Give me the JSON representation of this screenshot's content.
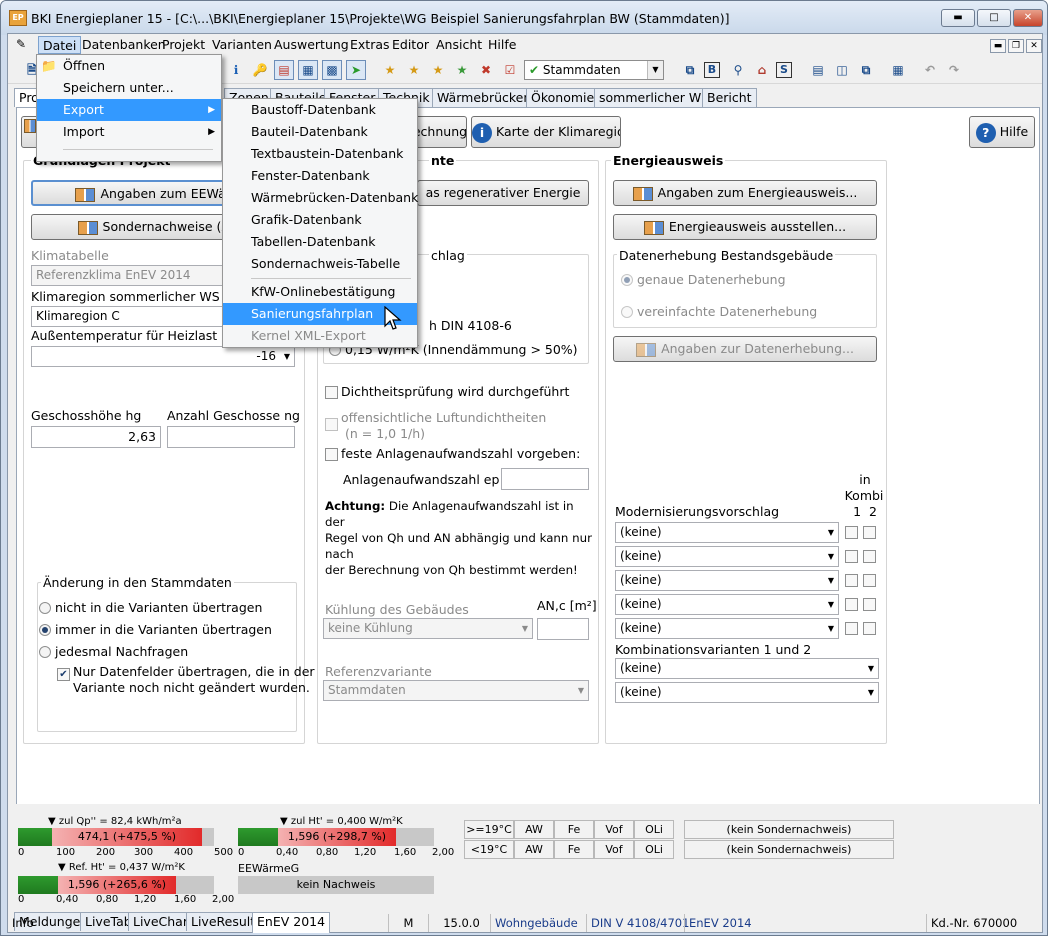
{
  "window": {
    "title": "BKI Energieplaner 15 - [C:\\...\\BKI\\Energieplaner 15\\Projekte\\WG Beispiel Sanierungsfahrplan BW (Stammdaten)]"
  },
  "menubar": [
    "Datei",
    "Datenbanken",
    "Projekt",
    "Varianten",
    "Auswertung",
    "Extras",
    "Editor",
    "Ansicht",
    "Hilfe"
  ],
  "toolbar": {
    "variant_selected": "Stammdaten",
    "text_icons": [
      "B",
      "S"
    ]
  },
  "tabs": [
    "Pro",
    "Zonen",
    "Bauteile",
    "Fenster",
    "Technik",
    "Wärmebrücken",
    "Ökonomie",
    "sommerlicher WS",
    "Bericht"
  ],
  "datei_menu": {
    "items": [
      "Öffnen",
      "Speichern unter...",
      "Export",
      "Import"
    ]
  },
  "export_menu": {
    "items": [
      "Baustoff-Datenbank",
      "Bauteil-Datenbank",
      "Textbaustein-Datenbank",
      "Fenster-Datenbank",
      "Wärmebrücken-Datenbank",
      "Grafik-Datenbank",
      "Tabellen-Datenbank",
      "Sondernachweis-Tabelle",
      "KfW-Onlinebestätigung",
      "Sanierungsfahrplan",
      "Kernel XML-Export"
    ],
    "highlighted": "Sanierungsfahrplan",
    "disabled": "Kernel XML-Export"
  },
  "topbuttons": {
    "berechnung": "rechnung",
    "klimaregionen": "Karte der Klimaregionen",
    "hilfe": "Hilfe"
  },
  "left": {
    "title": "Grundlagen Projekt",
    "btn_eew": "Angaben zum EEWärme",
    "btn_sonder": "Sondernachweise (z. B.",
    "klimatabelle_label": "Klimatabelle",
    "klimatabelle_value": "Referenzklima EnEV 2014",
    "klimaregion_label": "Klimaregion sommerlicher WS",
    "klimaregion_value": "Klimaregion C",
    "aussentemp_label": "Außentemperatur für Heizlast DIN E",
    "aussentemp_value": "-16",
    "geschoss_label": "Geschosshöhe hg",
    "geschoss_value": "2,63",
    "anzahl_label": "Anzahl Geschosse ng",
    "anzahl_value": "",
    "aenderung_title": "Änderung in den Stammdaten",
    "radio1": "nicht in die Varianten übertragen",
    "radio2": "immer in die Varianten übertragen",
    "radio3": "jedesmal Nachfragen",
    "checkbox_line1": "Nur Datenfelder übertragen, die in der",
    "checkbox_line2": "Variante noch nicht geändert wurden."
  },
  "middle": {
    "title": "nte",
    "btn_regen": "as regenerativer Energie",
    "grp_title": "chlag",
    "din_text": "h DIN 4108-6",
    "innen_text": "0,15 W/m²K (Innendämmung > 50%)",
    "dicht": "Dichtheitsprüfung wird durchgeführt",
    "luft1": "offensichtliche Luftundichtheiten",
    "luft2": "(n = 1,0 1/h)",
    "feste": "feste Anlagenaufwandszahl vorgeben:",
    "anlagen_label": "Anlagenaufwandszahl ep [-]",
    "achtung_bold": "Achtung:",
    "achtung1": "Die Anlagenaufwandszahl ist in der",
    "achtung2": "Regel von Qh und AN abhängig und kann nur nach",
    "achtung3": "der Berechnung von Qh bestimmt werden!",
    "kuehlung_label": "Kühlung des Gebäudes",
    "an_label": "AN,c [m²]",
    "kuehlung_value": "keine Kühlung",
    "referenz_label": "Referenzvariante",
    "referenz_value": "Stammdaten"
  },
  "right": {
    "title": "Energieausweis",
    "btn1": "Angaben zum Energieausweis...",
    "btn2": "Energieausweis ausstellen...",
    "erhebung_title": "Datenerhebung Bestandsgebäude",
    "radio_genau": "genaue Datenerhebung",
    "radio_verein": "vereinfachte Datenerhebung",
    "btn3": "Angaben zur Datenerhebung...",
    "in_kombi_1": "in",
    "in_kombi_2": "Kombi",
    "kombi_cols": "1  2",
    "modern_label": "Modernisierungsvorschlag",
    "modern_values": [
      "(keine)",
      "(keine)",
      "(keine)",
      "(keine)",
      "(keine)"
    ],
    "kombi_label": "Kombinationsvarianten 1 und 2",
    "kombi_values": [
      "(keine)",
      "(keine)"
    ]
  },
  "bars": {
    "qp_label": "zul Qp'' = 82,4 kWh/m²a",
    "qp_value": "474,1 (+475,5 %)",
    "qp_scale": [
      "0",
      "100",
      "200",
      "300",
      "400",
      "500"
    ],
    "ht_label": "zul Ht' = 0,400 W/m²K",
    "ht_value": "1,596 (+298,7 %)",
    "ht_scale": [
      "0",
      "0,40",
      "0,80",
      "1,20",
      "1,60",
      "2,00"
    ],
    "ref_label": "Ref. Ht' = 0,437 W/m²K",
    "ref_value": "1,596 (+265,6 %)",
    "ref_scale": [
      "0",
      "0,40",
      "0,80",
      "1,20",
      "1,60",
      "2,00"
    ],
    "eew_label": "EEWärmeG",
    "eew_value": "kein Nachweis"
  },
  "grid": {
    "row1": [
      ">=19°C",
      "AW",
      "Fe",
      "Vof",
      "OLi"
    ],
    "row2": [
      "<19°C",
      "AW",
      "Fe",
      "Vof",
      "OLi"
    ],
    "sonder1": "(kein Sondernachweis)",
    "sonder2": "(kein Sondernachweis)"
  },
  "bottomtabs": [
    "Meldungen",
    "LiveTab",
    "LiveChart",
    "LiveResults",
    "EnEV 2014"
  ],
  "statusbar": {
    "info": "Info",
    "m": "M",
    "version": "15.0.0",
    "type": "Wohngebäude",
    "din": "DIN V 4108/4701",
    "enev": "EnEV 2014",
    "kd": "Kd.-Nr. 670000"
  }
}
